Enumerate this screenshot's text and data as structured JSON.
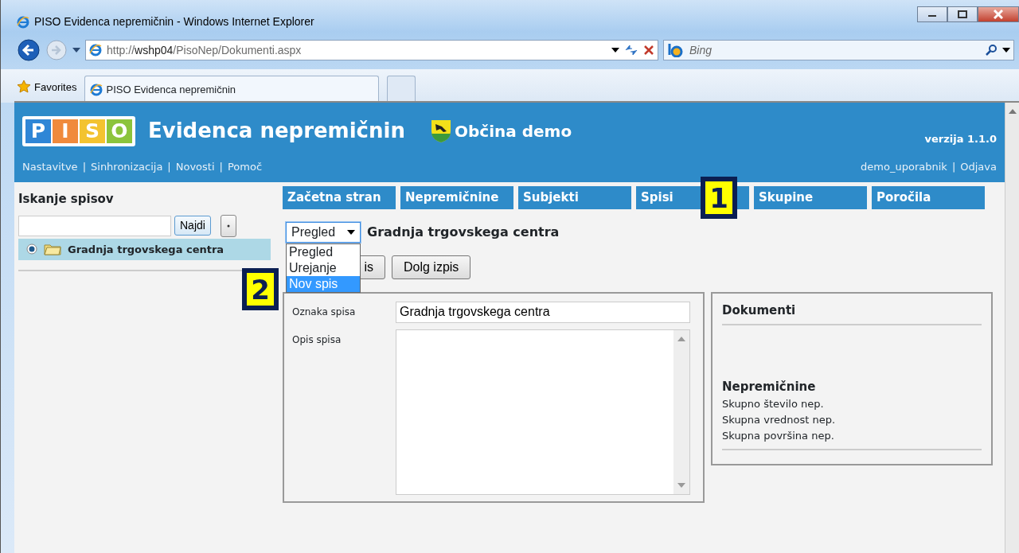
{
  "browser": {
    "title": "PISO Evidenca nepremičnin - Windows Internet Explorer",
    "address": "http://**wshp04**/PisoNep/Dokumenti.aspx",
    "search_placeholder": "Bing",
    "favorites": "Favorites",
    "tabs": [
      {
        "label": "PISO Evidenca nepremičnin",
        "selected": true
      }
    ]
  },
  "header": {
    "logo_letters": [
      {
        "letter": "P",
        "color": "#2f86d6"
      },
      {
        "letter": "I",
        "color": "#f08a3c"
      },
      {
        "letter": "S",
        "color": "#f3c330"
      },
      {
        "letter": "O",
        "color": "#8cc43c"
      }
    ],
    "app_title": "Evidenca nepremičnin",
    "municipality": "Občina demo",
    "version": "verzija 1.1.0",
    "links": [
      "Nastavitve",
      "Sinhronizacija",
      "Novosti",
      "Pomoč"
    ],
    "separator": "|",
    "user": "demo_uporabnik",
    "logout": "Odjava"
  },
  "nav_tabs": [
    "Začetna stran",
    "Nepremičnine",
    "Subjekti",
    "Spisi",
    "Skupine",
    "Poročila"
  ],
  "sidebar": {
    "title": "Iskanje spisov",
    "search_button": "Najdi",
    "results": [
      {
        "label": "Gradnja trgovskega centra",
        "selected": true
      }
    ]
  },
  "view_select": {
    "value": "Pregled",
    "expanded": true,
    "options": [
      {
        "label": "Pregled",
        "highlighted": false
      },
      {
        "label": "Urejanje",
        "highlighted": false
      },
      {
        "label": "Nov spis",
        "highlighted": true
      }
    ]
  },
  "record_title": "Gradnja trgovskega centra",
  "buttons": [
    "is",
    "Dolg izpis"
  ],
  "form": {
    "fields": [
      {
        "kind": "input",
        "label": "Oznaka spisa",
        "value": "Gradnja trgovskega centra"
      },
      {
        "kind": "textarea",
        "label": "Opis spisa"
      }
    ]
  },
  "documents": {
    "title": "Dokumenti",
    "section_title": "Nepremičnine",
    "lines": [
      "Skupno število nep.",
      "Skupna vrednost nep.",
      "Skupna površina nep."
    ]
  },
  "callouts": [
    "1",
    "2"
  ]
}
